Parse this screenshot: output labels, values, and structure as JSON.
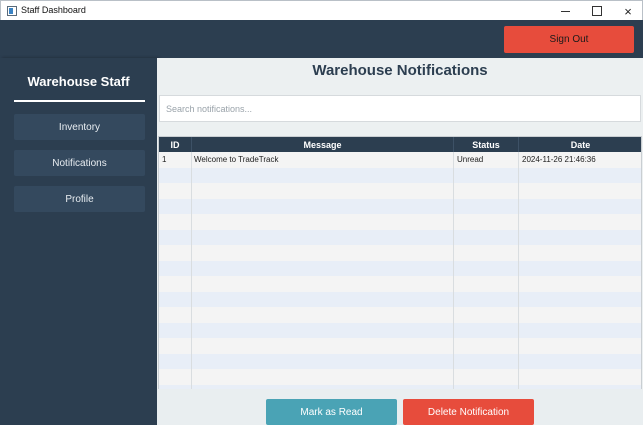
{
  "window": {
    "title": "Staff Dashboard",
    "close_glyph": "×"
  },
  "topbar": {
    "signout_label": "Sign Out",
    "signout_color": "#e74c3c"
  },
  "sidebar": {
    "title": "Warehouse Staff",
    "items": [
      {
        "label": "Inventory"
      },
      {
        "label": "Notifications"
      },
      {
        "label": "Profile"
      }
    ]
  },
  "main": {
    "title": "Warehouse Notifications",
    "search_placeholder": "Search notifications..."
  },
  "table": {
    "columns": [
      "ID",
      "Message",
      "Status",
      "Date"
    ],
    "rows": [
      {
        "id": "1",
        "message": "Welcome to TradeTrack",
        "status": "Unread",
        "date": "2024-11-26 21:46:36"
      }
    ]
  },
  "actions": {
    "mark_read_label": "Mark as Read",
    "delete_label": "Delete Notification"
  },
  "colors": {
    "primary": "#2c3e50",
    "danger": "#e74c3c",
    "info": "#4aa3b5"
  }
}
